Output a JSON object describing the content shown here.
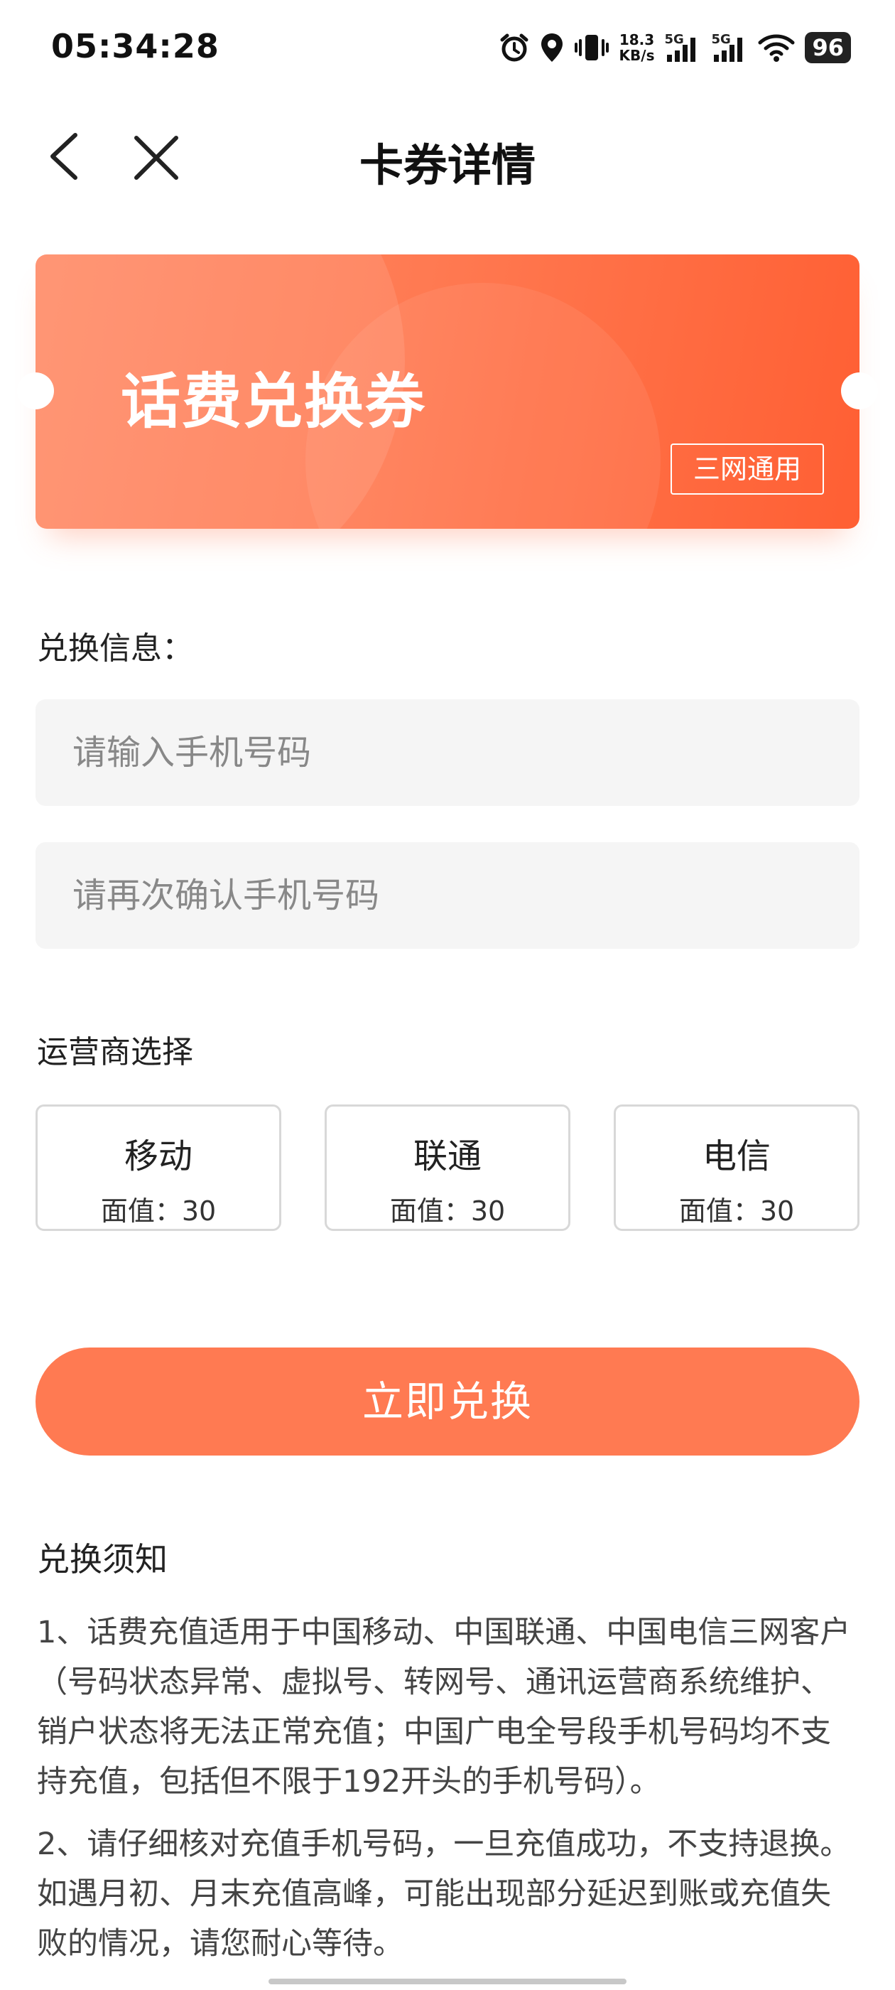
{
  "status_bar": {
    "time": "05:34:28",
    "net_speed_value": "18.3",
    "net_speed_unit": "KB/s",
    "sim1": "5G",
    "sim2": "5G",
    "battery": "96"
  },
  "nav": {
    "title": "卡券详情"
  },
  "coupon": {
    "title": "话费兑换券",
    "badge": "三网通用",
    "colors": {
      "start": "#ff8a66",
      "end": "#ff5f33"
    }
  },
  "form": {
    "section_label": "兑换信息：",
    "phone_placeholder": "请输入手机号码",
    "confirm_placeholder": "请再次确认手机号码",
    "phone_value": "",
    "confirm_value": ""
  },
  "carrier_section": {
    "label": "运营商选择",
    "options": [
      {
        "name": "移动",
        "value": "面值：30"
      },
      {
        "name": "联通",
        "value": "面值：30"
      },
      {
        "name": "电信",
        "value": "面值：30"
      }
    ]
  },
  "redeem_button": {
    "label": "立即兑换",
    "color": "#ff7a52"
  },
  "notice": {
    "title": "兑换须知",
    "items": [
      "1、话费充值适用于中国移动、中国联通、中国电信三网客户（号码状态异常、虚拟号、转网号、通讯运营商系统维护、销户状态将无法正常充值；中国广电全号段手机号码均不支持充值，包括但不限于192开头的手机号码）。",
      "2、请仔细核对充值手机号码，一旦充值成功，不支持退换。如遇月初、月末充值高峰，可能出现部分延迟到账或充值失败的情况，请您耐心等待。"
    ]
  }
}
